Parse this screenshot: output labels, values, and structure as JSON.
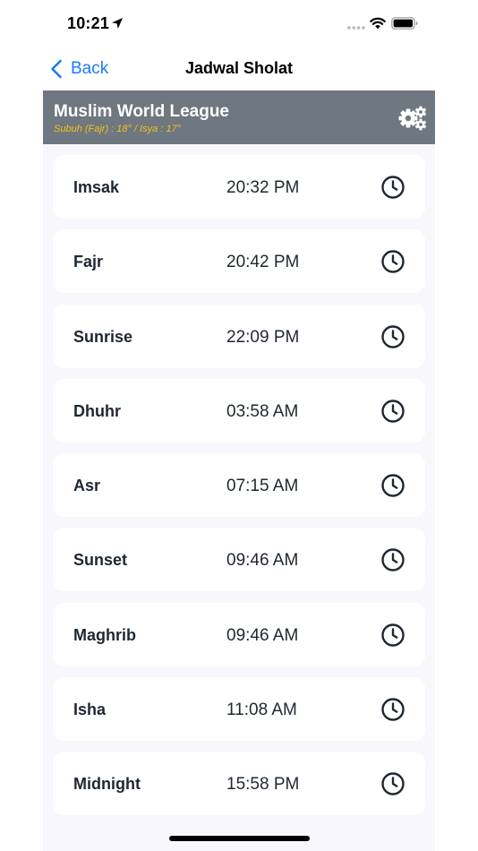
{
  "status_bar": {
    "time": "10:21"
  },
  "nav": {
    "back_label": "Back",
    "title": "Jadwal Sholat"
  },
  "header": {
    "method_name": "Muslim World League",
    "method_params": "Subuh (Fajr) : 18° / Isya : 17°"
  },
  "prayers": [
    {
      "name": "Imsak",
      "time": "20:32 PM"
    },
    {
      "name": "Fajr",
      "time": "20:42 PM"
    },
    {
      "name": "Sunrise",
      "time": "22:09 PM"
    },
    {
      "name": "Dhuhr",
      "time": "03:58 AM"
    },
    {
      "name": "Asr",
      "time": "07:15 AM"
    },
    {
      "name": "Sunset",
      "time": "09:46 AM"
    },
    {
      "name": "Maghrib",
      "time": "09:46 AM"
    },
    {
      "name": "Isha",
      "time": "11:08 AM"
    },
    {
      "name": "Midnight",
      "time": "15:58 PM"
    }
  ],
  "colors": {
    "accent": "#1a7cf5",
    "header_band": "#6f7780",
    "params_text": "#f2c318",
    "list_background": "#f7f7fc",
    "card": "#ffffff",
    "text": "#1f2732"
  },
  "icons": {
    "status": [
      "location-arrow-icon",
      "signal-icon",
      "wifi-icon",
      "battery-icon"
    ],
    "nav": "chevron-left-icon",
    "header": "gears-icon",
    "row": "clock-icon"
  }
}
